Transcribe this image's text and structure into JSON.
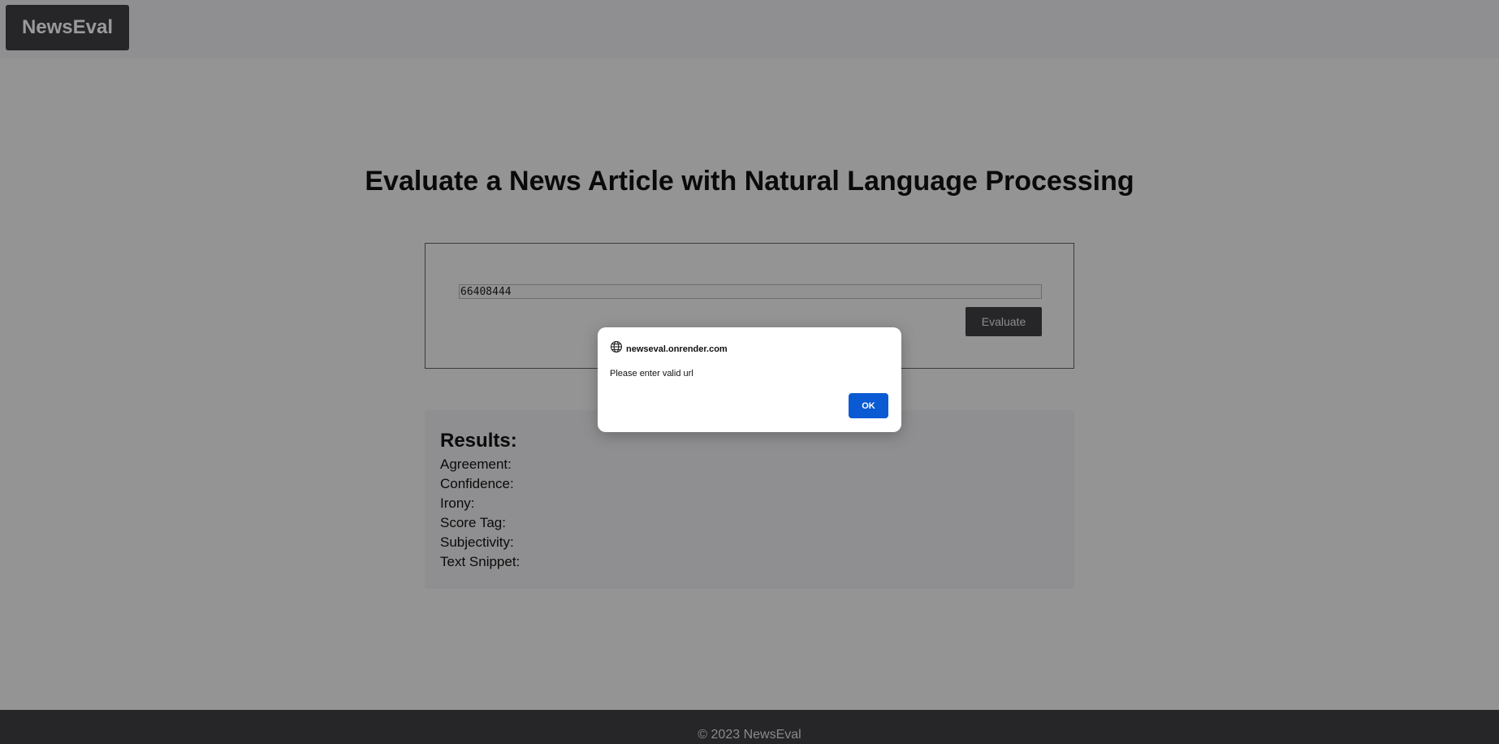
{
  "navbar": {
    "brand": "NewsEval"
  },
  "main": {
    "title": "Evaluate a News Article with Natural Language Processing",
    "url_input_value": "66408444",
    "evaluate_label": "Evaluate"
  },
  "results": {
    "heading": "Results:",
    "rows": [
      "Agreement:",
      "Confidence:",
      "Irony:",
      "Score Tag:",
      "Subjectivity:",
      "Text Snippet:"
    ]
  },
  "footer": {
    "text": "© 2023 NewsEval"
  },
  "dialog": {
    "icon": "globe-icon",
    "origin": "newseval.onrender.com",
    "message": "Please enter valid url",
    "ok_label": "OK"
  },
  "colors": {
    "page_background": "#949495",
    "dark": "#262628",
    "dialog_button": "#0a5ad4"
  }
}
